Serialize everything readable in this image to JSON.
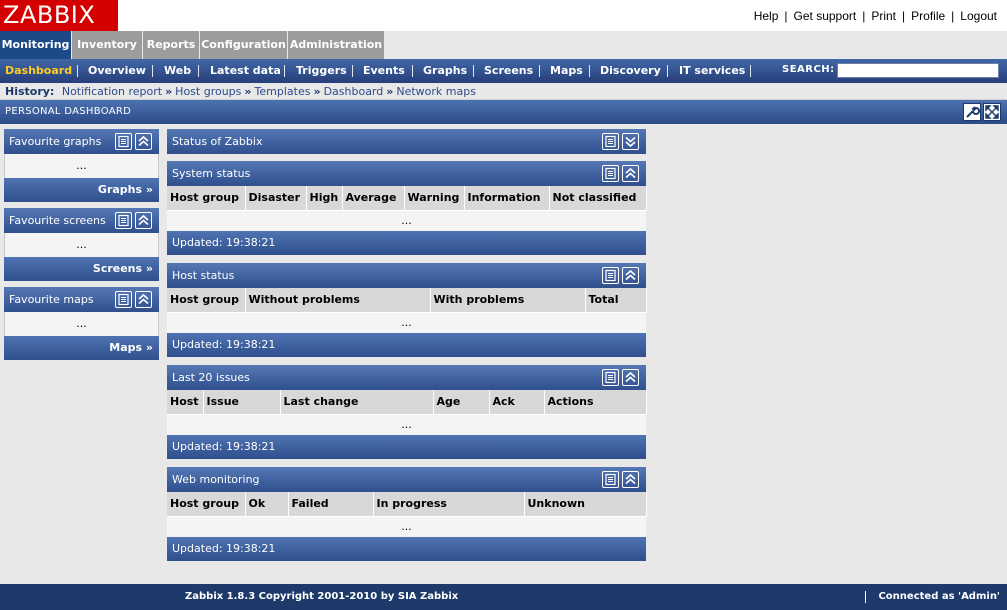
{
  "app": {
    "logo": "ZABBIX"
  },
  "top_links": [
    "Help",
    "Get support",
    "Print",
    "Profile",
    "Logout"
  ],
  "main_menu": [
    "Monitoring",
    "Inventory",
    "Reports",
    "Configuration",
    "Administration"
  ],
  "sub_menu": [
    "Dashboard",
    "Overview",
    "Web",
    "Latest data",
    "Triggers",
    "Events",
    "Graphs",
    "Screens",
    "Maps",
    "Discovery",
    "IT services"
  ],
  "search": {
    "label": "SEARCH:",
    "value": ""
  },
  "history": {
    "label": "History:",
    "items": [
      "Notification report",
      "Host groups",
      "Templates",
      "Dashboard",
      "Network maps"
    ]
  },
  "page_title": "PERSONAL DASHBOARD",
  "favourites": [
    {
      "title": "Favourite graphs",
      "body": "...",
      "link": "Graphs »"
    },
    {
      "title": "Favourite screens",
      "body": "...",
      "link": "Screens »"
    },
    {
      "title": "Favourite maps",
      "body": "...",
      "link": "Maps »"
    }
  ],
  "status_of_zabbix": {
    "title": "Status of Zabbix"
  },
  "system_status": {
    "title": "System status",
    "columns": [
      "Host group",
      "Disaster",
      "High",
      "Average",
      "Warning",
      "Information",
      "Not classified"
    ],
    "empty": "...",
    "updated": "Updated: 19:38:21"
  },
  "host_status": {
    "title": "Host status",
    "columns": [
      "Host group",
      "Without problems",
      "With problems",
      "Total"
    ],
    "empty": "...",
    "updated": "Updated: 19:38:21"
  },
  "last_issues": {
    "title": "Last 20 issues",
    "columns": [
      "Host",
      "Issue",
      "Last change",
      "Age",
      "Ack",
      "Actions"
    ],
    "empty": "...",
    "updated": "Updated: 19:38:21"
  },
  "web_monitoring": {
    "title": "Web monitoring",
    "columns": [
      "Host group",
      "Ok",
      "Failed",
      "In progress",
      "Unknown"
    ],
    "empty": "...",
    "updated": "Updated: 19:38:21"
  },
  "footer": {
    "copyright": "Zabbix 1.8.3 Copyright 2001-2010 by SIA Zabbix",
    "connected": "Connected as 'Admin'"
  },
  "colors": {
    "brand_red": "#d40000",
    "active_tab": "#1d4a86",
    "submenu_active": "#ffcc22",
    "footer": "#1d3a6b"
  }
}
